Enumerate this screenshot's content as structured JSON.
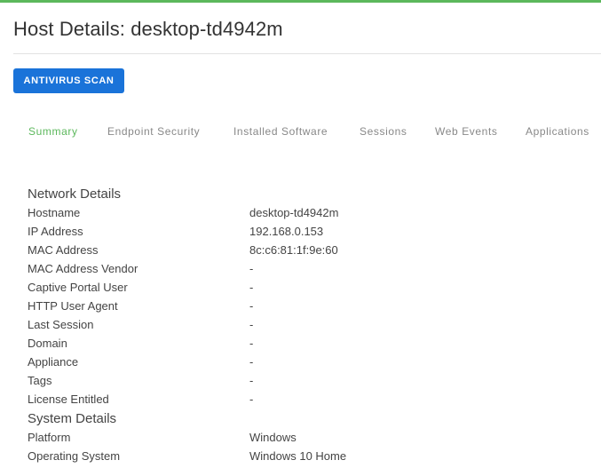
{
  "header": {
    "title": "Host Details: desktop-td4942m",
    "accent_color": "#5cb85c"
  },
  "actions": {
    "antivirus_scan_label": "ANTIVIRUS SCAN",
    "button_color": "#1a73d9"
  },
  "tabs": [
    {
      "label": "Summary",
      "active": true
    },
    {
      "label": "Endpoint Security",
      "active": false
    },
    {
      "label": "Installed Software",
      "active": false
    },
    {
      "label": "Sessions",
      "active": false
    },
    {
      "label": "Web Events",
      "active": false
    },
    {
      "label": "Applications",
      "active": false
    }
  ],
  "network_details": {
    "heading": "Network Details",
    "rows": [
      {
        "label": "Hostname",
        "value": "desktop-td4942m"
      },
      {
        "label": "IP Address",
        "value": "192.168.0.153"
      },
      {
        "label": "MAC Address",
        "value": "8c:c6:81:1f:9e:60"
      },
      {
        "label": "MAC Address Vendor",
        "value": "-"
      },
      {
        "label": "Captive Portal User",
        "value": "-"
      },
      {
        "label": "HTTP User Agent",
        "value": "-"
      },
      {
        "label": "Last Session",
        "value": "-"
      },
      {
        "label": "Domain",
        "value": "-"
      },
      {
        "label": "Appliance",
        "value": "-"
      },
      {
        "label": "Tags",
        "value": "-"
      },
      {
        "label": "License Entitled",
        "value": "-"
      }
    ]
  },
  "system_details": {
    "heading": "System Details",
    "rows": [
      {
        "label": "Platform",
        "value": "Windows"
      },
      {
        "label": "Operating System",
        "value": "Windows 10 Home"
      }
    ]
  }
}
